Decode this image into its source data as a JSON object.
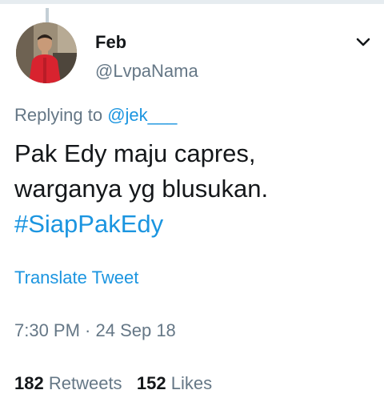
{
  "tweet": {
    "display_name": "Feb",
    "handle": "@LvpaNama",
    "replying_prefix": "Replying to",
    "replying_to": "@jek___",
    "text_line_1": "Pak Edy maju capres,",
    "text_line_2": "warganya yg blusukan.",
    "hashtag": "#SiapPakEdy",
    "translate_label": "Translate Tweet",
    "timestamp": "7:30 PM · 24 Sep 18",
    "retweets_count": "182",
    "retweets_label": "Retweets",
    "likes_count": "152",
    "likes_label": "Likes"
  },
  "icons": {
    "more": "chevron-down-icon",
    "avatar": "profile-photo"
  },
  "colors": {
    "link": "#1b95e0",
    "secondary_text": "#657786",
    "primary_text": "#14171a"
  }
}
